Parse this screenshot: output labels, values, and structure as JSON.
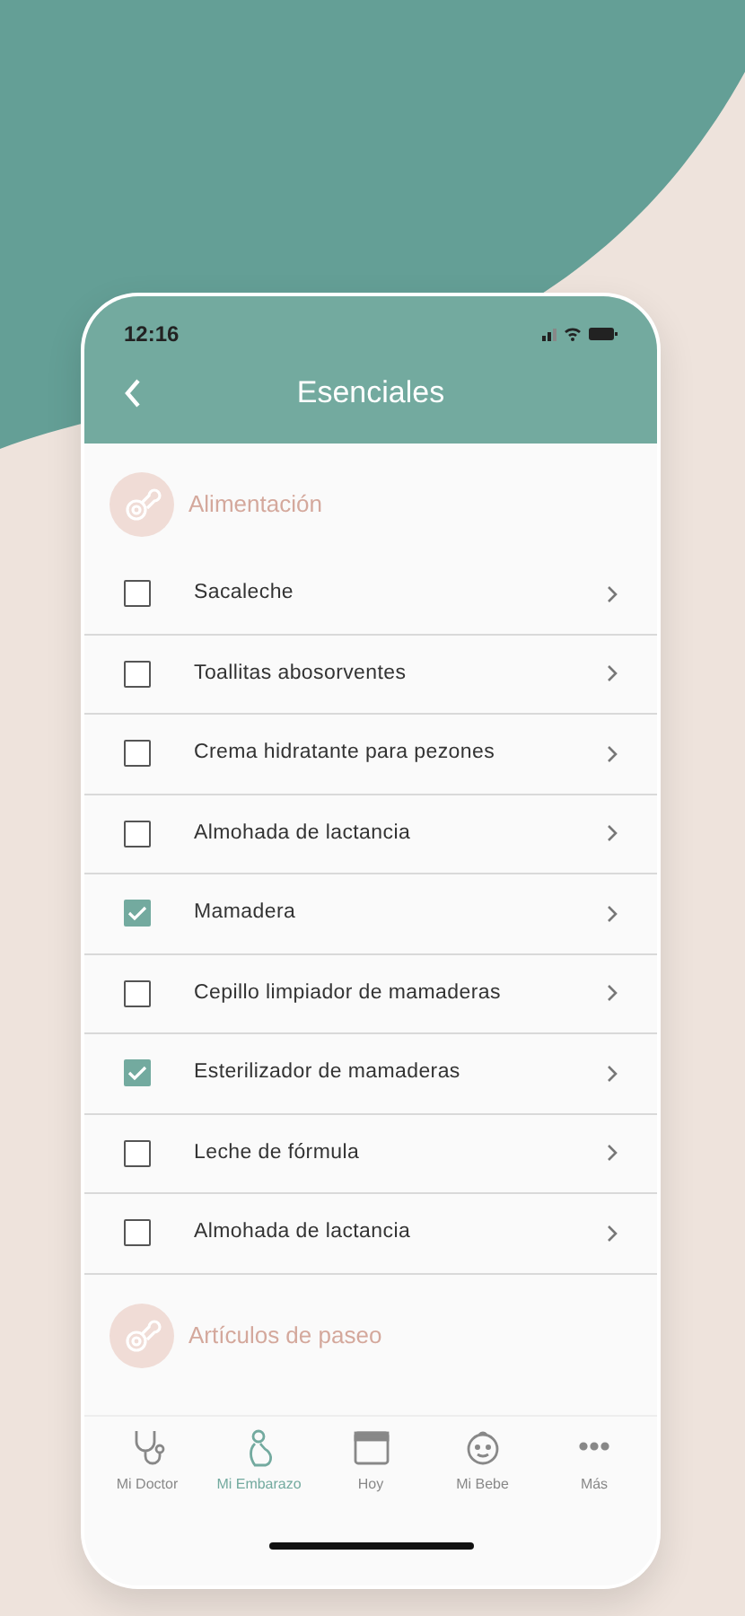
{
  "status_bar": {
    "time": "12:16"
  },
  "header": {
    "title": "Esenciales"
  },
  "sections": [
    {
      "title": "Alimentación",
      "items": [
        {
          "label": "Sacaleche",
          "checked": false
        },
        {
          "label": "Toallitas abosorventes",
          "checked": false
        },
        {
          "label": "Crema hidratante para pezones",
          "checked": false
        },
        {
          "label": "Almohada de lactancia",
          "checked": false
        },
        {
          "label": "Mamadera",
          "checked": true
        },
        {
          "label": "Cepillo limpiador de mamaderas",
          "checked": false
        },
        {
          "label": "Esterilizador de mamaderas",
          "checked": true
        },
        {
          "label": "Leche de fórmula",
          "checked": false
        },
        {
          "label": "Almohada de lactancia",
          "checked": false
        }
      ]
    },
    {
      "title": "Artículos de paseo"
    }
  ],
  "tabs": [
    {
      "label": "Mi Doctor",
      "kind": "doctor",
      "selected": false
    },
    {
      "label": "Mi Embarazo",
      "kind": "pregnancy",
      "selected": true
    },
    {
      "label": "Hoy",
      "kind": "calendar",
      "selected": false
    },
    {
      "label": "Mi Bebe",
      "kind": "baby",
      "selected": false
    },
    {
      "label": "Más",
      "kind": "more",
      "selected": false
    }
  ]
}
